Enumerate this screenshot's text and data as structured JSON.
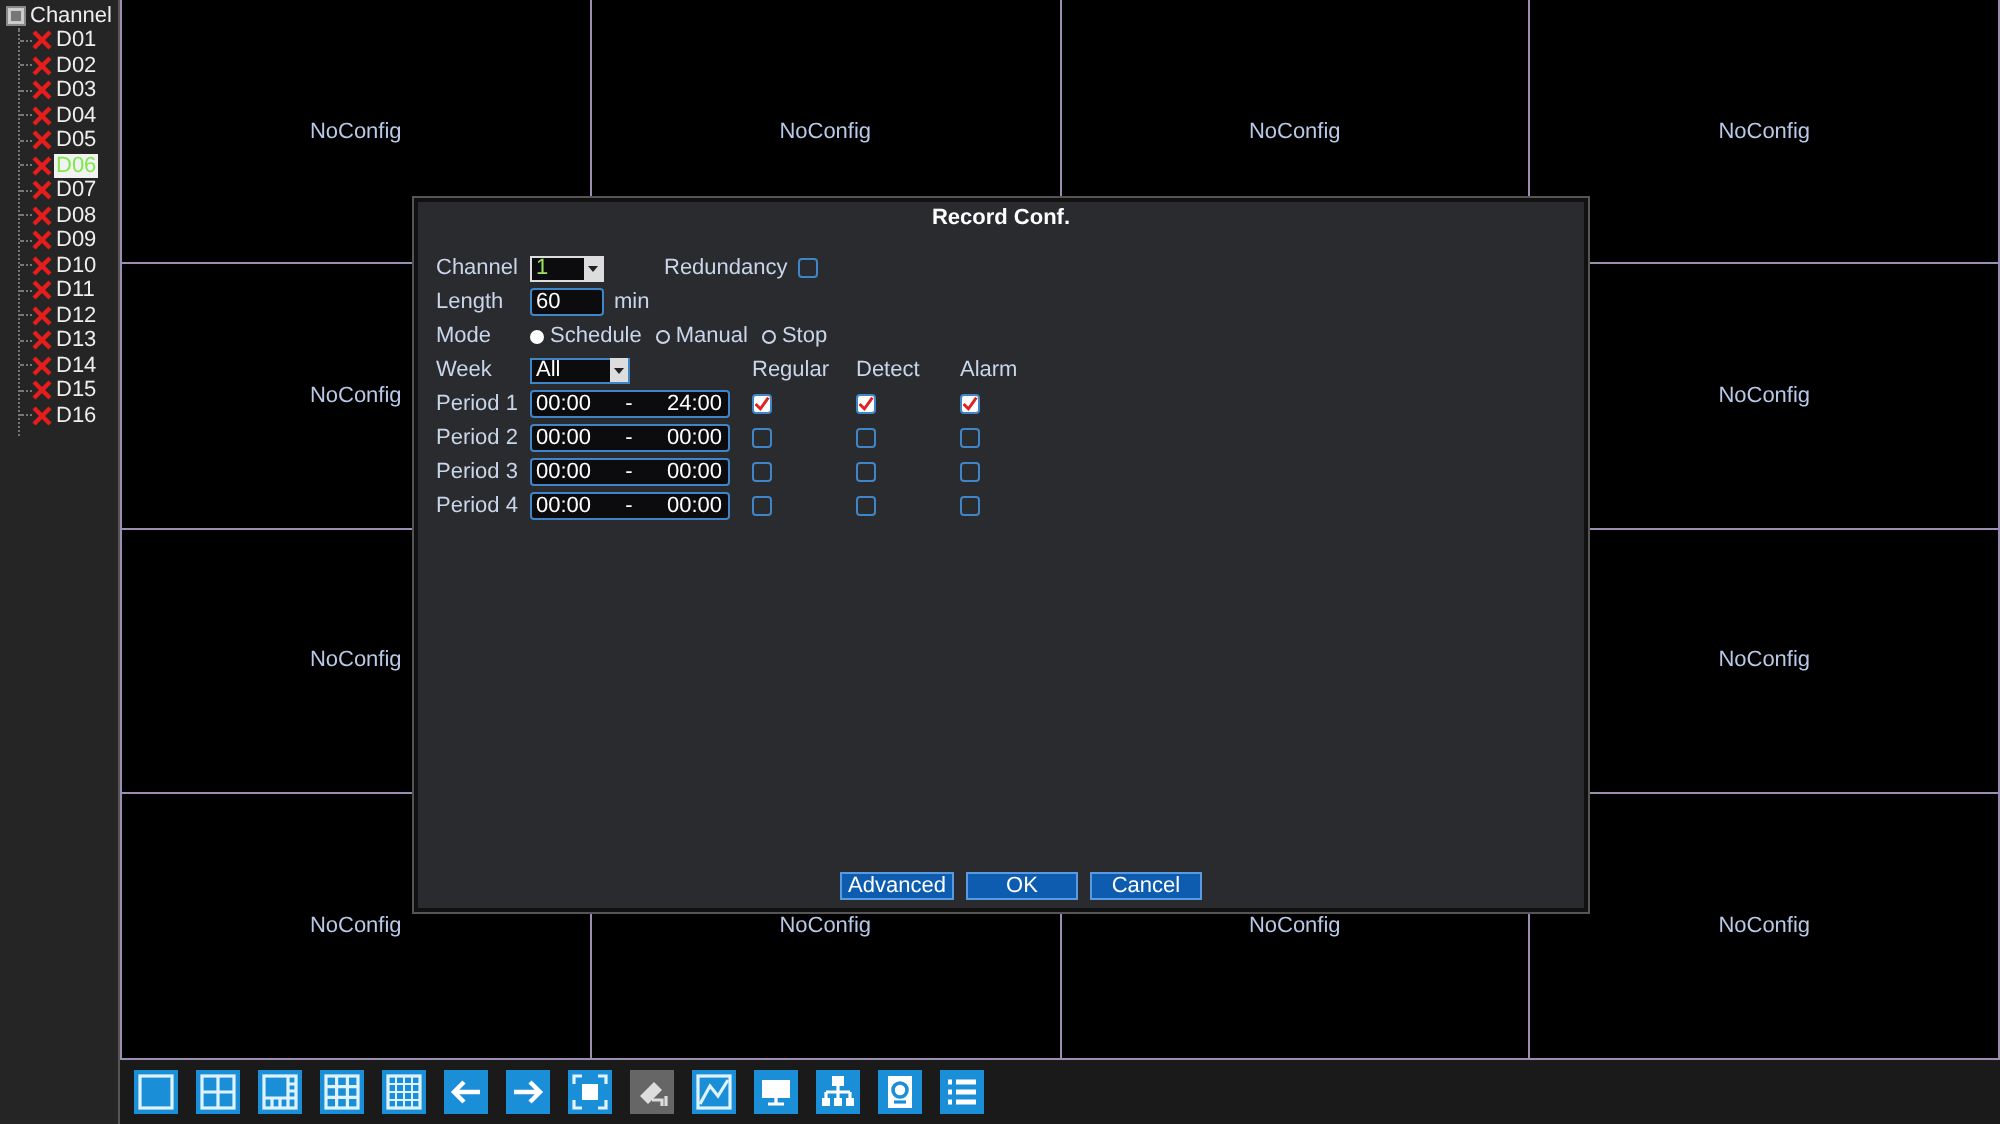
{
  "sidebar": {
    "title": "Channel",
    "channels": [
      {
        "label": "D01",
        "selected": false
      },
      {
        "label": "D02",
        "selected": false
      },
      {
        "label": "D03",
        "selected": false
      },
      {
        "label": "D04",
        "selected": false
      },
      {
        "label": "D05",
        "selected": false
      },
      {
        "label": "D06",
        "selected": true
      },
      {
        "label": "D07",
        "selected": false
      },
      {
        "label": "D08",
        "selected": false
      },
      {
        "label": "D09",
        "selected": false
      },
      {
        "label": "D10",
        "selected": false
      },
      {
        "label": "D11",
        "selected": false
      },
      {
        "label": "D12",
        "selected": false
      },
      {
        "label": "D13",
        "selected": false
      },
      {
        "label": "D14",
        "selected": false
      },
      {
        "label": "D15",
        "selected": false
      },
      {
        "label": "D16",
        "selected": false
      }
    ]
  },
  "grid": {
    "cells": [
      {
        "label": "NoConfig"
      },
      {
        "label": "NoConfig"
      },
      {
        "label": "NoConfig"
      },
      {
        "label": "NoConfig"
      },
      {
        "label": "NoConfig"
      },
      {},
      {},
      {
        "label": "NoConfig"
      },
      {
        "label": "NoConfig"
      },
      {},
      {},
      {
        "label": "NoConfig"
      },
      {
        "label": "NoConfig"
      },
      {
        "label": "NoConfig"
      },
      {
        "label": "NoConfig"
      },
      {
        "label": "NoConfig"
      }
    ]
  },
  "dialog": {
    "title": "Record Conf.",
    "channel": {
      "label": "Channel",
      "value": "1"
    },
    "redundancy": {
      "label": "Redundancy",
      "checked": false
    },
    "length": {
      "label": "Length",
      "value": "60",
      "unit": "min"
    },
    "mode": {
      "label": "Mode",
      "options": [
        {
          "label": "Schedule",
          "selected": true
        },
        {
          "label": "Manual",
          "selected": false
        },
        {
          "label": "Stop",
          "selected": false
        }
      ]
    },
    "week": {
      "label": "Week",
      "value": "All"
    },
    "columns": [
      "Regular",
      "Detect",
      "Alarm"
    ],
    "periods": [
      {
        "label": "Period 1",
        "start": "00:00",
        "separator": "-",
        "end": "24:00",
        "checks": [
          {
            "checked": true
          },
          {
            "checked": true
          },
          {
            "checked": true
          }
        ]
      },
      {
        "label": "Period 2",
        "start": "00:00",
        "separator": "-",
        "end": "00:00",
        "checks": [
          {
            "checked": false
          },
          {
            "checked": false
          },
          {
            "checked": false
          }
        ]
      },
      {
        "label": "Period 3",
        "start": "00:00",
        "separator": "-",
        "end": "00:00",
        "checks": [
          {
            "checked": false
          },
          {
            "checked": false
          },
          {
            "checked": false
          }
        ]
      },
      {
        "label": "Period 4",
        "start": "00:00",
        "separator": "-",
        "end": "00:00",
        "checks": [
          {
            "checked": false
          },
          {
            "checked": false
          },
          {
            "checked": false
          }
        ]
      }
    ],
    "buttons": [
      "Advanced",
      "OK",
      "Cancel"
    ]
  },
  "toolbar": [
    {
      "disabled": false
    },
    {
      "disabled": false
    },
    {
      "disabled": false
    },
    {
      "disabled": false
    },
    {
      "disabled": false
    },
    {
      "disabled": false
    },
    {
      "disabled": false
    },
    {
      "disabled": false
    },
    {
      "disabled": true
    },
    {
      "disabled": false
    },
    {
      "disabled": false
    },
    {
      "disabled": false
    },
    {
      "disabled": false
    },
    {
      "disabled": false
    }
  ]
}
